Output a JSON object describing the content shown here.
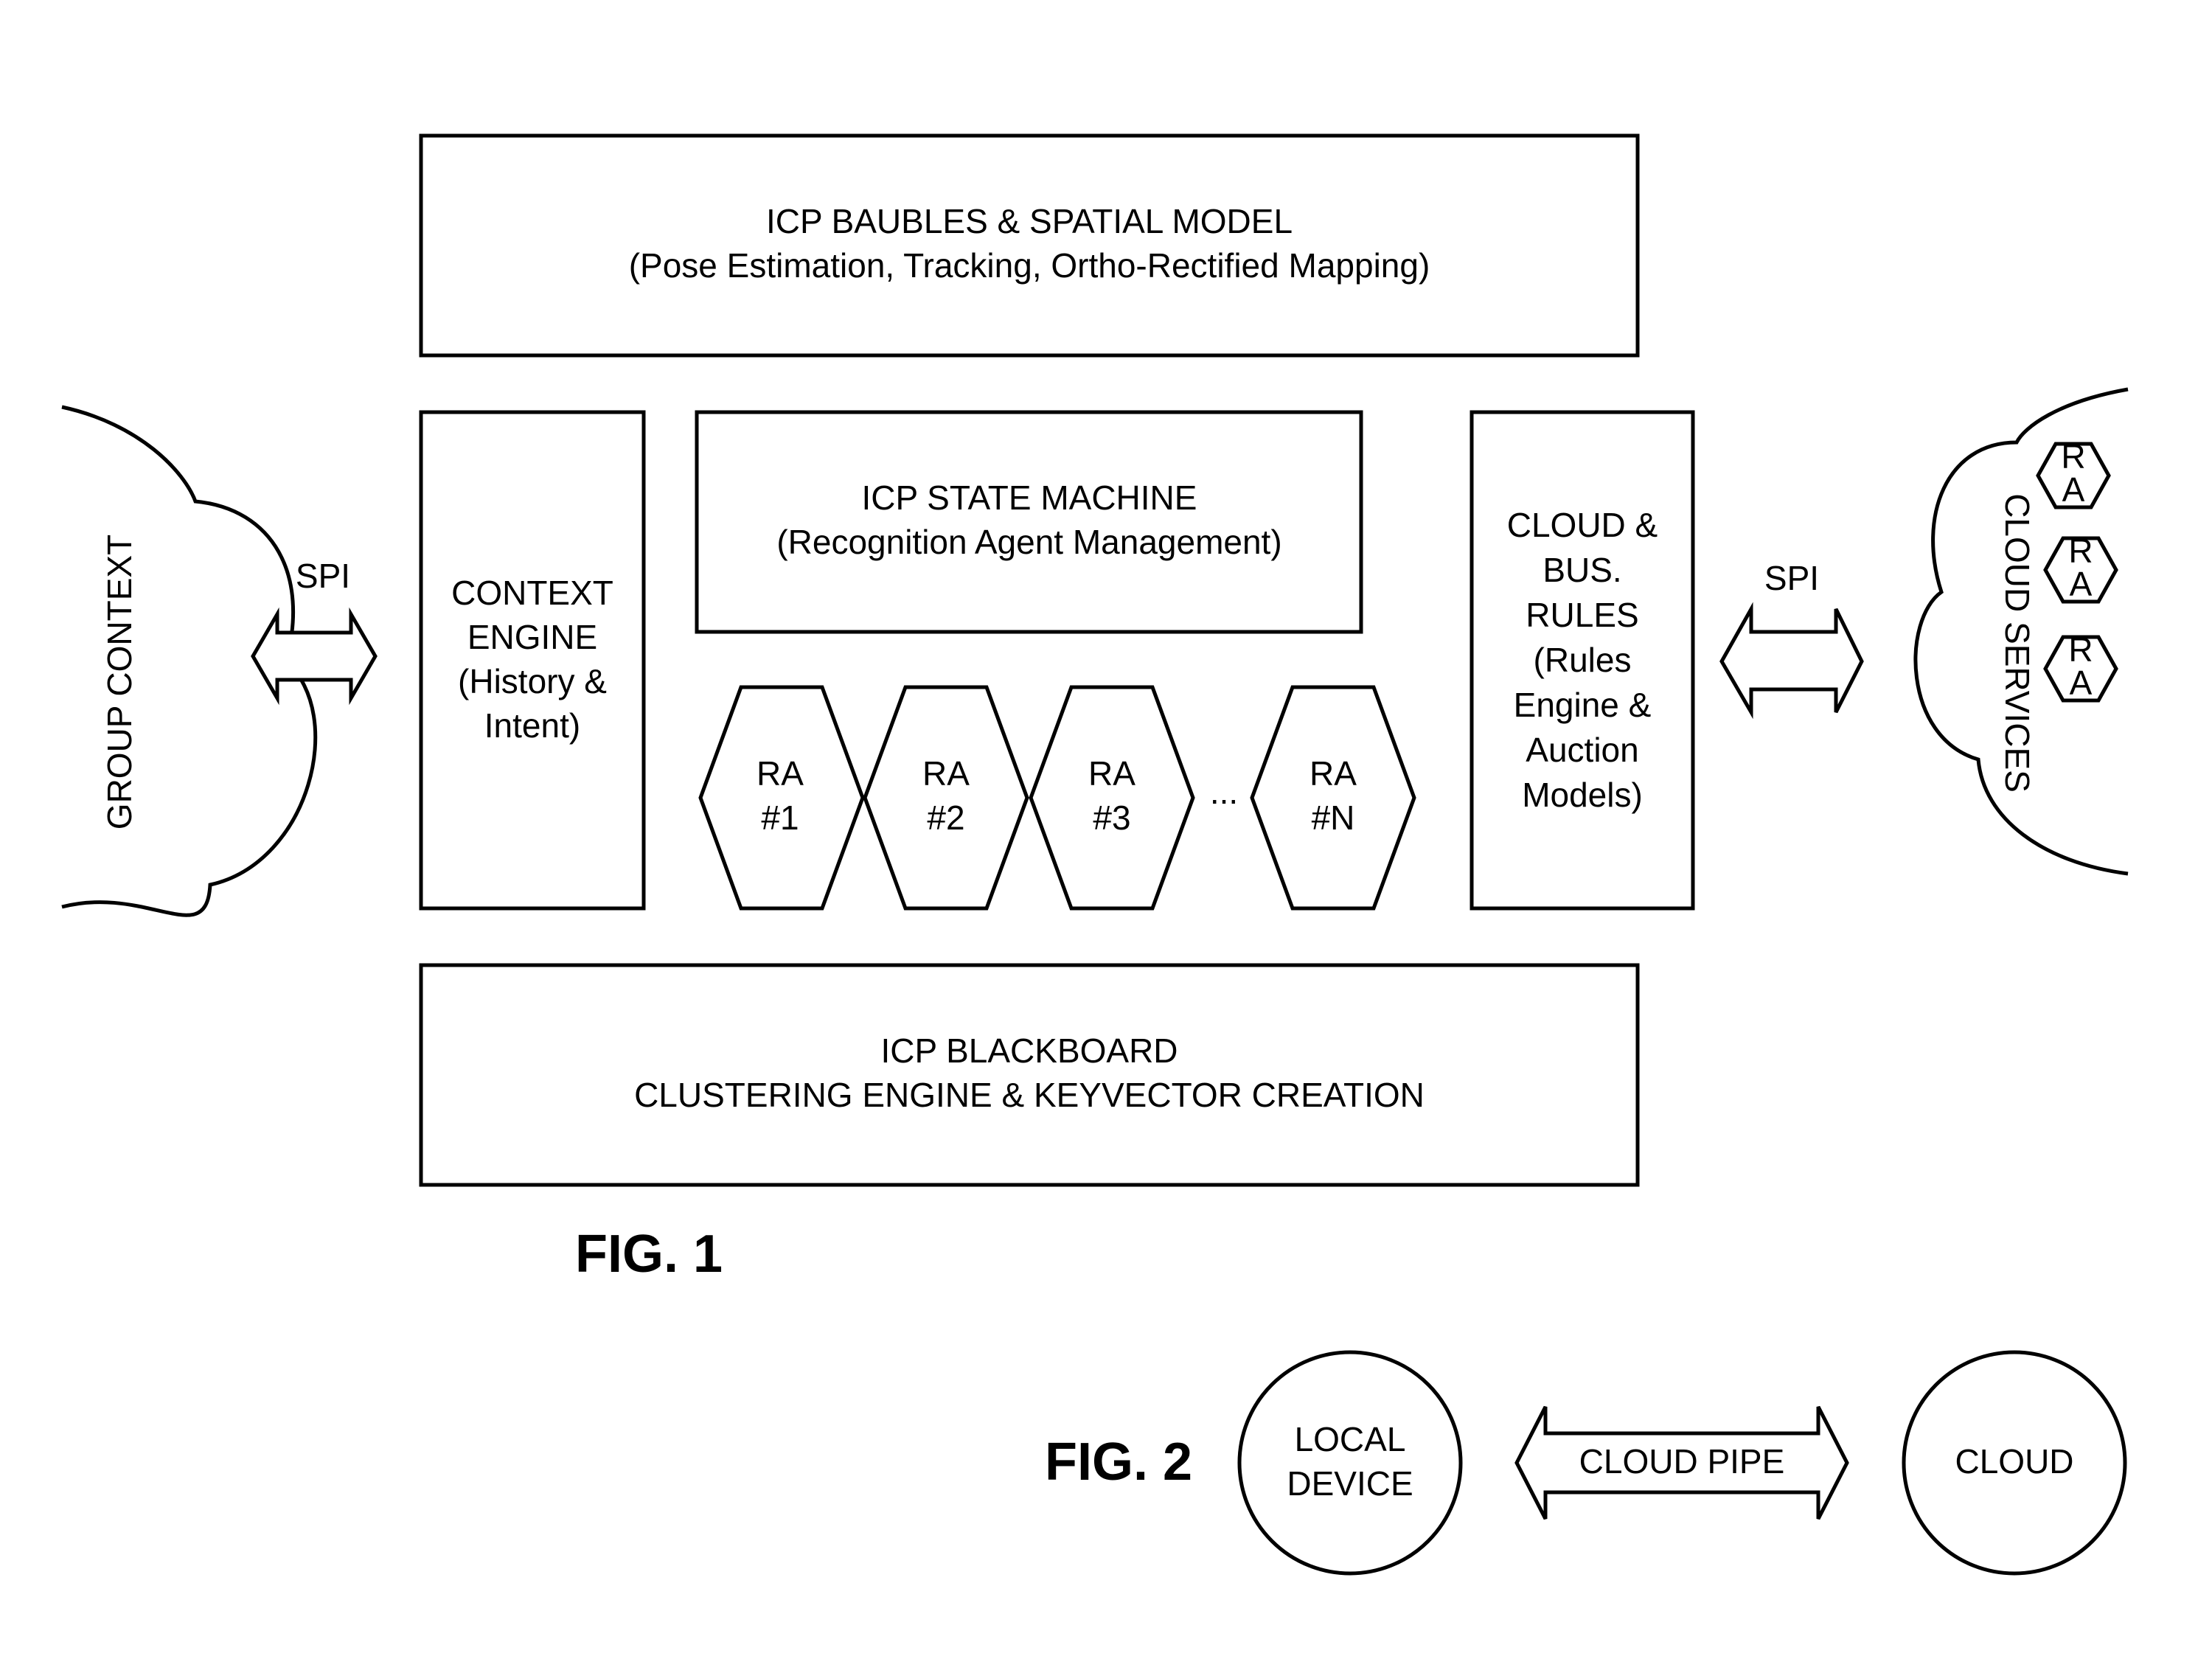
{
  "fig1": {
    "caption": "FIG. 1",
    "baubles": {
      "title": "ICP BAUBLES & SPATIAL MODEL",
      "subtitle": "(Pose Estimation, Tracking, Ortho-Rectified Mapping)"
    },
    "context_engine": {
      "lines": [
        "CONTEXT",
        "ENGINE",
        "(History &",
        "Intent)"
      ]
    },
    "state_machine": {
      "title": "ICP STATE MACHINE",
      "subtitle": "(Recognition Agent Management)"
    },
    "cloud_bus_rules": {
      "lines": [
        "CLOUD &",
        "BUS.",
        "RULES",
        "(Rules",
        "Engine &",
        "Auction",
        "Models)"
      ]
    },
    "blackboard": {
      "title": "ICP BLACKBOARD",
      "subtitle": "CLUSTERING ENGINE & KEYVECTOR CREATION"
    },
    "recognition_agents": [
      {
        "line1": "RA",
        "line2": "#1"
      },
      {
        "line1": "RA",
        "line2": "#2"
      },
      {
        "line1": "RA",
        "line2": "#3"
      },
      {
        "line1": "RA",
        "line2": "#N"
      }
    ],
    "ellipsis": "...",
    "group_context": "GROUP CONTEXT",
    "cloud_services": "CLOUD SERVICES",
    "cloud_ras": [
      {
        "line1": "R",
        "line2": "A"
      },
      {
        "line1": "R",
        "line2": "A"
      },
      {
        "line1": "R",
        "line2": "A"
      }
    ],
    "spi_left": "SPI",
    "spi_right": "SPI"
  },
  "fig2": {
    "caption": "FIG. 2",
    "local_device": [
      "LOCAL",
      "DEVICE"
    ],
    "cloud_pipe": "CLOUD PIPE",
    "cloud": "CLOUD"
  }
}
